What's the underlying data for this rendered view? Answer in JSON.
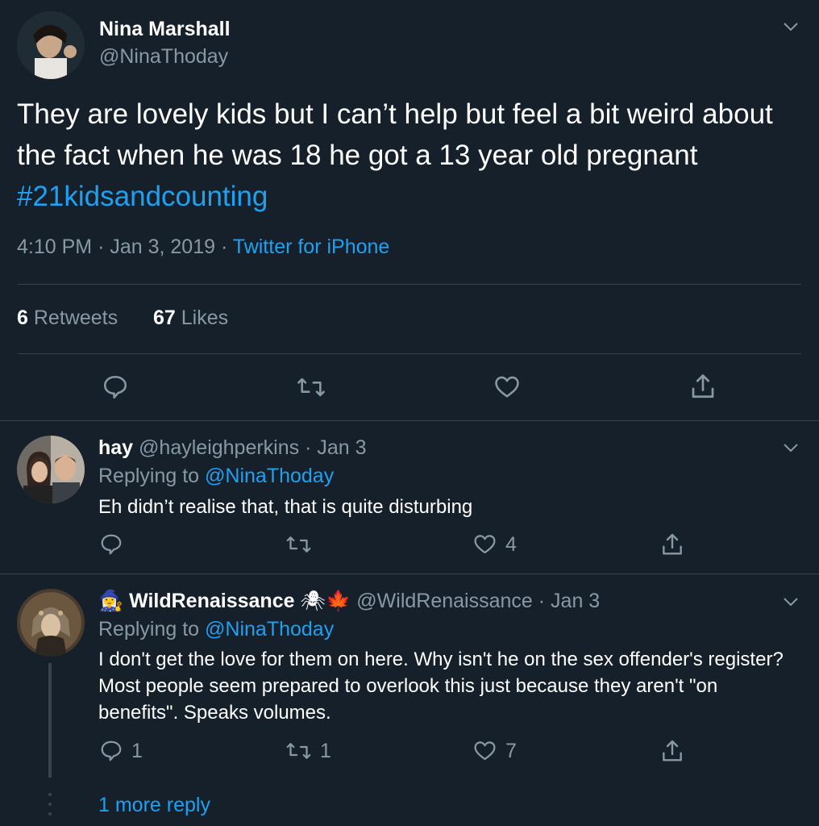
{
  "main_tweet": {
    "name": "Nina Marshall",
    "handle": "@NinaThoday",
    "text_plain": "They are lovely kids but I can’t help but feel a bit weird about the fact when he was 18 he got a 13 year old pregnant ",
    "hashtag": "#21kidsandcounting",
    "time": "4:10 PM",
    "date": "Jan 3, 2019",
    "sep": "·",
    "source": "Twitter for iPhone",
    "retweets_count": "6",
    "retweets_label": "Retweets",
    "likes_count": "67",
    "likes_label": "Likes"
  },
  "replies": [
    {
      "name": "hay",
      "handle": "@hayleighperkins",
      "date": "· Jan 3",
      "replying_label": "Replying to",
      "replying_to": "@NinaThoday",
      "text": "Eh didn’t realise that, that is quite disturbing",
      "comments": "",
      "retweets": "",
      "likes": "4"
    },
    {
      "name": "WildRenaissance",
      "name_emoji_prefix": "🧙‍♀️",
      "name_emoji_suffix": "🕷🍁",
      "handle": "@WildRenaissance",
      "date": "· Jan 3",
      "replying_label": "Replying to",
      "replying_to": "@NinaThoday",
      "text": "I don't get the love for them on here. Why isn't he on the sex offender's register? Most people seem prepared to overlook this just because they aren't \"on benefits\". Speaks volumes.",
      "comments": "1",
      "retweets": "1",
      "likes": "7"
    }
  ],
  "more_reply": "1 more reply",
  "icons": [
    "chevron-down-icon",
    "reply-icon",
    "retweet-icon",
    "like-icon",
    "share-icon"
  ],
  "colors": {
    "background": "#15202b",
    "accent": "#1da1f2",
    "muted": "#8899a6",
    "divider": "#38444d"
  }
}
